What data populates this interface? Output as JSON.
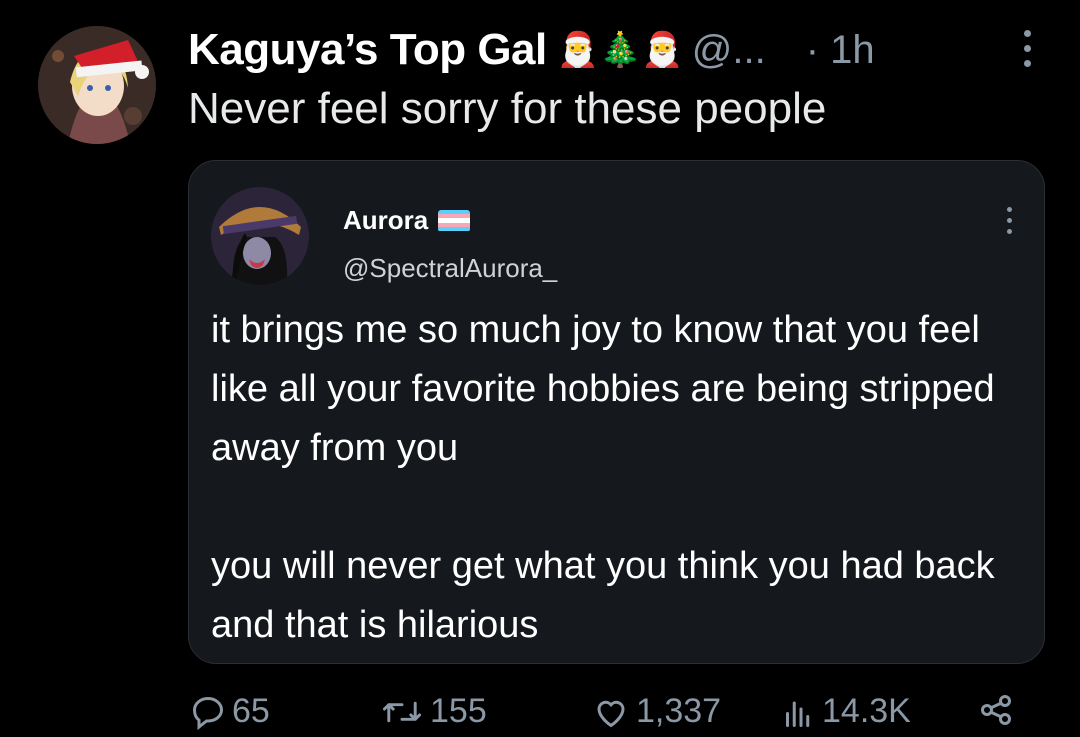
{
  "tweet": {
    "display_name": "Kaguya’s Top Gal",
    "emojis": "🎅🎄🎅",
    "handle": "@...",
    "time": "· 1h",
    "text": "Never feel sorry for these people"
  },
  "quote": {
    "name": "Aurora",
    "handle": "@SpectralAurora_",
    "paragraph1": "it brings me so much joy to know that you feel like all your favorite hobbies are being stripped away from you",
    "paragraph2": "you will never get what you think you had back and that is hilarious"
  },
  "actions": {
    "replies": "65",
    "retweets": "155",
    "likes": "1,337",
    "views": "14.3K"
  },
  "colors": {
    "background": "#000000",
    "card": "#15181c",
    "muted": "#8b98a5",
    "flag_blue": "#5bcefa",
    "flag_pink": "#f5a9b8",
    "flag_white": "#ffffff"
  }
}
